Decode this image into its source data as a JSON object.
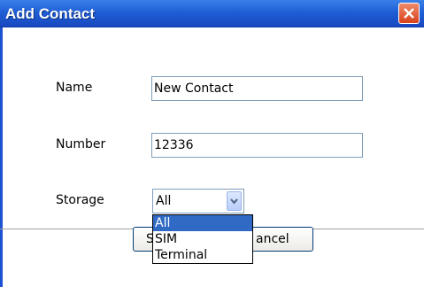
{
  "window": {
    "title": "Add Contact"
  },
  "form": {
    "name_label": "Name",
    "name_value": "New Contact",
    "number_label": "Number",
    "number_value": "12336",
    "storage_label": "Storage",
    "storage_value": "All"
  },
  "storage_options": [
    {
      "label": "All",
      "selected": true
    },
    {
      "label": "SIM",
      "selected": false
    },
    {
      "label": "Terminal",
      "selected": false
    }
  ],
  "buttons": {
    "save_visible": "S",
    "cancel_visible": "ancel"
  },
  "colors": {
    "titlebar": "#1f5fd6",
    "highlight": "#316ac5",
    "close": "#d9421c"
  }
}
